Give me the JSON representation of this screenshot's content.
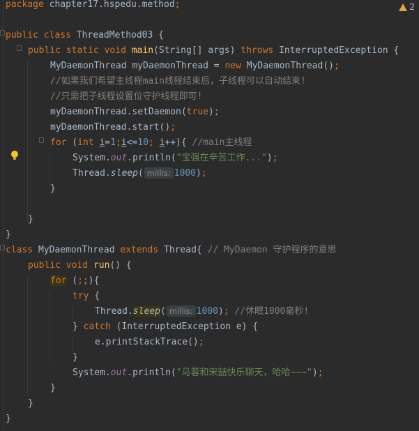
{
  "editor": {
    "warning_count": "2",
    "hints": {
      "millis": "millis:"
    },
    "code": {
      "l1_pkg_kw": "package",
      "l1_pkg_name": " chapter17.hspedu.method",
      "l1_semi": ";",
      "l3_public": "public",
      "l3_class": "class",
      "l3_name": " ThreadMethod03 {",
      "l4_public": "public",
      "l4_static": "static",
      "l4_void": "void",
      "l4_main": "main",
      "l4_params": "(String[] args) ",
      "l4_throws": "throws",
      "l4_exc": " InterruptedException {",
      "l5_a": "MyDaemonThread myDaemonThread = ",
      "l5_new": "new",
      "l5_b": " MyDaemonThread()",
      "l5_semi": ";",
      "l6_comment": "//如果我们希望主线程main线程结束后，子线程可以自动结束!",
      "l7_comment": "//只需把子线程设置位守护线程即可!",
      "l8_a": "myDaemonThread.setDaemon(",
      "l8_true": "true",
      "l8_b": ")",
      "l8_semi": ";",
      "l9_a": "myDaemonThread.start()",
      "l9_semi": ";",
      "l10_for": "for",
      "l10_open": " (",
      "l10_int": "int",
      "l10_i1": "i",
      "l10_eq": "=",
      "l10_n1": "1",
      "l10_semi1": ";",
      "l10_i2": "i",
      "l10_lt": "<=",
      "l10_n10": "10",
      "l10_semi2": ";",
      "l10_i3": "i",
      "l10_inc": "++){ ",
      "l10_comment": "//main主线程",
      "l11_sys": "System.",
      "l11_out": "out",
      "l11_print": ".println(",
      "l11_str": "\"宝强在辛苦工作...\"",
      "l11_close": ")",
      "l11_semi": ";",
      "l12_thread": "Thread.",
      "l12_sleep": "sleep",
      "l12_open": "(",
      "l12_num": "1000",
      "l12_close": ")",
      "l12_semi": ";",
      "l13_brace": "}",
      "l15_brace": "}",
      "l16_brace": "}",
      "l17_class": "class",
      "l17_name": " MyDaemonThread ",
      "l17_extends": "extends",
      "l17_thread": " Thread{ ",
      "l17_comment": "// MyDaemon 守护程序的意思",
      "l18_public": "public",
      "l18_void": "void",
      "l18_run": "run",
      "l18_rest": "() {",
      "l19_for": "for",
      "l19_rest": " (",
      "l19_semis": ";;",
      "l19_end": "){",
      "l20_try": "try",
      "l20_rest": " {",
      "l21_thread": "Thread.",
      "l21_sleep": "sleep",
      "l21_open": "(",
      "l21_num": "1000",
      "l21_close": ")",
      "l21_semi": ";",
      "l21_comment": " //休眠1000毫秒!",
      "l22_close": "} ",
      "l22_catch": "catch",
      "l22_rest": " (InterruptedException e) {",
      "l23_a": "e.printStackTrace()",
      "l23_semi": ";",
      "l24_brace": "}",
      "l25_sys": "System.",
      "l25_out": "out",
      "l25_print": ".println(",
      "l25_str": "\"马蓉和宋喆快乐聊天，哈哈~~~\"",
      "l25_close": ")",
      "l25_semi": ";",
      "l26_brace": "}",
      "l27_brace": "}",
      "l28_brace": "}"
    }
  }
}
